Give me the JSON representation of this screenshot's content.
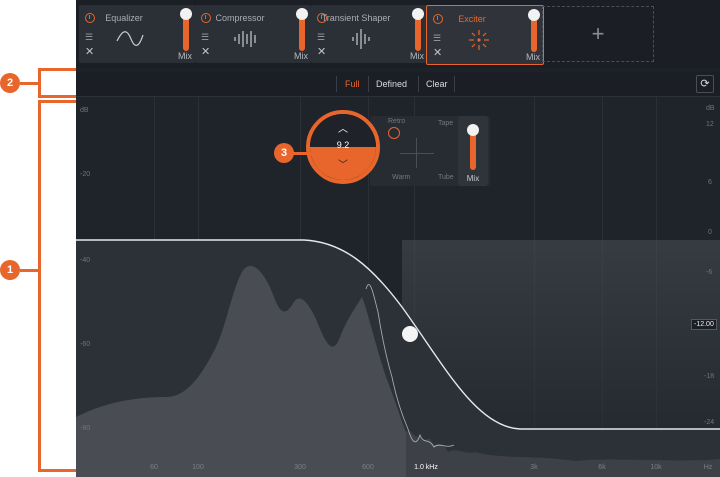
{
  "modules": [
    {
      "name": "Equalizer",
      "mix_label": "Mix",
      "active": false
    },
    {
      "name": "Compressor",
      "mix_label": "Mix",
      "active": false
    },
    {
      "name": "Transient Shaper",
      "mix_label": "Mix",
      "active": false
    },
    {
      "name": "Exciter",
      "mix_label": "Mix",
      "active": true
    }
  ],
  "add_slot": {
    "icon": "plus-icon",
    "label": "+"
  },
  "toolbar": {
    "full": "Full",
    "defined": "Defined",
    "clear": "Clear",
    "refresh_icon": "refresh-icon",
    "refresh_glyph": "⟳"
  },
  "plot": {
    "left_db_labels": [
      "dB",
      "-20",
      "-40",
      "-60",
      "-80"
    ],
    "right_db_labels": [
      "dB",
      "12",
      "6",
      "0",
      "-6",
      "-12",
      "-18",
      "-24"
    ],
    "freq_labels": [
      "60",
      "100",
      "300",
      "600",
      "1.0 kHz",
      "3k",
      "6k",
      "10k",
      "Hz"
    ],
    "highlight_freq": "1.0 kHz",
    "readout": "-12.00"
  },
  "exciter_panel": {
    "retro": "Retro",
    "tape": "Tape",
    "warm": "Warm",
    "tube": "Tube",
    "mix_label": "Mix",
    "amount_value": "9.2"
  },
  "annotations": {
    "b1": "1",
    "b2": "2",
    "b3": "3"
  },
  "colors": {
    "accent": "#e8662b",
    "background": "#1d2128",
    "panel": "#2b2f36"
  }
}
